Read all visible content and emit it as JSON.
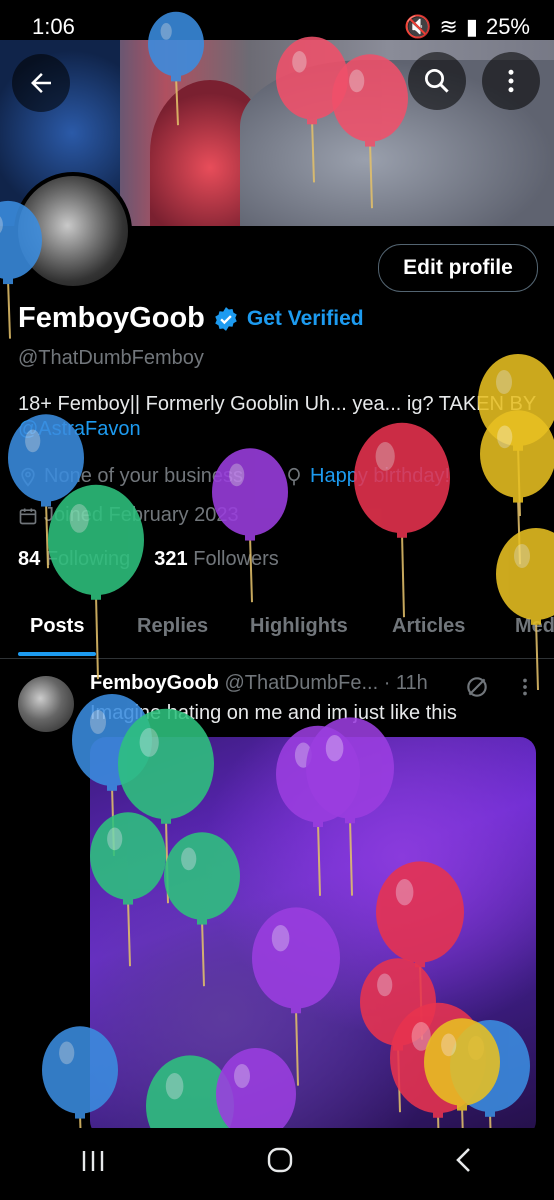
{
  "status_bar": {
    "time": "1:06",
    "battery": "25%"
  },
  "profile": {
    "display_name": "FemboyGoob",
    "get_verified": "Get Verified",
    "handle": "@ThatDumbFemboy",
    "bio_text": "18+ Femboy|| Formerly Gooblin  Uh... yea... ig? TAKEN BY ",
    "bio_mention": "@AstraFavon",
    "location": "None of your business",
    "birthday": "Happy birthday!",
    "joined": "Joined February 2023",
    "following_count": "84",
    "following_label": "Following",
    "followers_count": "321",
    "followers_label": "Followers",
    "edit_profile_label": "Edit profile"
  },
  "tabs": [
    "Posts",
    "Replies",
    "Highlights",
    "Articles",
    "Media"
  ],
  "active_tab": "Posts",
  "tweet": {
    "name": "FemboyGoob",
    "handle": "@ThatDumbFe...",
    "time": "· 11h",
    "text": "Imagine hating on me and im just like this"
  },
  "icons": {
    "back": "arrow-left-icon",
    "search": "search-icon",
    "more": "more-vertical-icon",
    "verified": "verified-badge-icon",
    "location": "location-pin-icon",
    "birthday": "balloon-icon",
    "calendar": "calendar-icon"
  },
  "colors": {
    "accent": "#1d9bf0",
    "background": "#000000",
    "secondary_text": "#71767b"
  }
}
